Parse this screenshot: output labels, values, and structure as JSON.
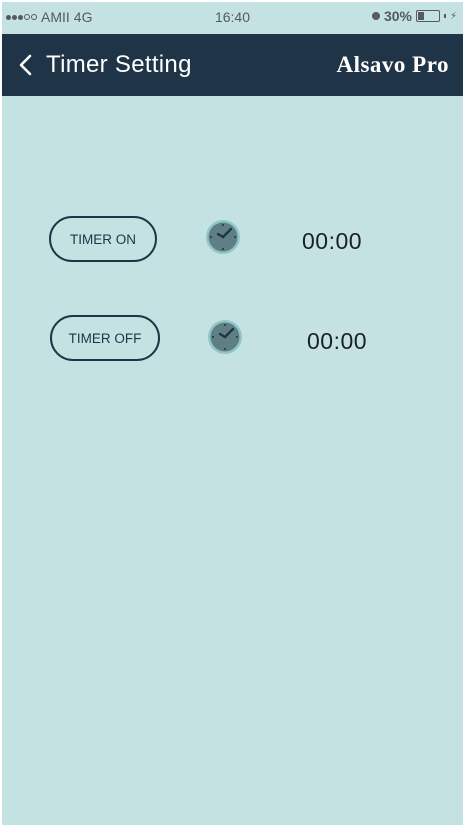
{
  "status_bar": {
    "carrier": "AMII",
    "network": "4G",
    "time": "16:40",
    "battery": "30%",
    "battery_level": 0.3
  },
  "nav": {
    "back_icon": "chevron-left-icon",
    "title": "Timer Setting",
    "brand": "Alsavo Pro"
  },
  "timers": [
    {
      "label": "TIMER ON",
      "time": "00:00",
      "icon": "clock-icon"
    },
    {
      "label": "TIMER OFF",
      "time": "00:00",
      "icon": "clock-icon"
    }
  ],
  "colors": {
    "background": "#c4e2e2",
    "nav_bar": "#1f3446",
    "clock_face": "#5f7f84",
    "clock_ring": "#8fc6c6"
  }
}
